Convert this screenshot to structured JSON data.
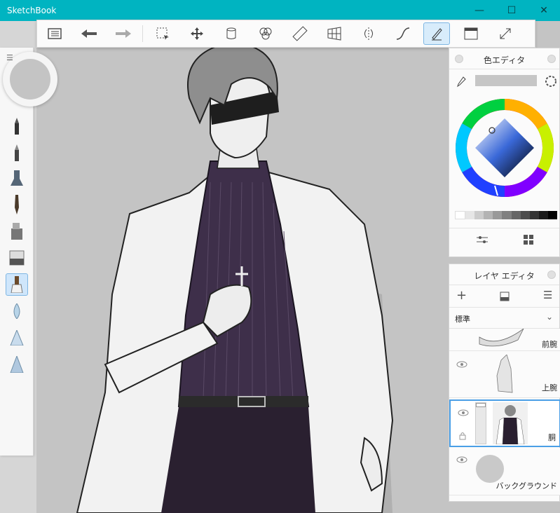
{
  "window": {
    "title": "SketchBook"
  },
  "toolbar": {
    "items": [
      "list-icon",
      "undo-icon",
      "redo-icon",
      "select-icon",
      "move-icon",
      "fill-bucket-icon",
      "color-blend-icon",
      "ruler-icon",
      "perspective-icon",
      "symmetry-icon",
      "curve-icon",
      "brush-active-icon",
      "layout-icon",
      "fullscreen-icon"
    ]
  },
  "color_editor": {
    "title": "色エディタ",
    "swatches": [
      "#ffffff",
      "#e6e6e6",
      "#cccccc",
      "#b3b3b3",
      "#999999",
      "#808080",
      "#666666",
      "#4d4d4d",
      "#333333",
      "#1a1a1a",
      "#000000"
    ],
    "current_color": "#c6c6c6"
  },
  "layer_editor": {
    "title": "レイヤ エディタ",
    "blend_mode": "標準",
    "layers": [
      {
        "name": "前腕"
      },
      {
        "name": "上腕"
      },
      {
        "name": "胴"
      },
      {
        "name": "バックグラウンド"
      }
    ]
  },
  "colors": {
    "accent": "#00b4c1",
    "selection": "#4a9fe6"
  }
}
